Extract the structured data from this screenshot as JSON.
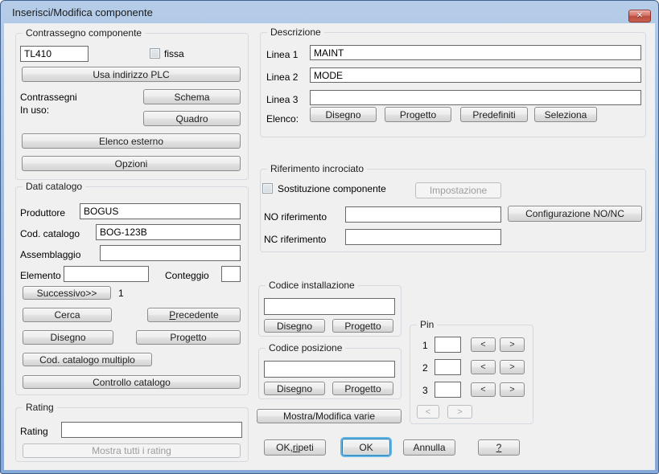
{
  "window": {
    "title": "Inserisci/Modifica componente"
  },
  "colors": {
    "titlebar_blue": "#a3bfe2",
    "frame_border": "#41618e",
    "close_red": "#c9604f",
    "default_button_ring": "#5fb5e4",
    "dialog_bg": "#f0f0f0"
  },
  "component_tag": {
    "group_label": "Contrassegno componente",
    "tag_value": "TL410",
    "fixed_checkbox_label": "fissa",
    "use_plc_button": "Usa indirizzo PLC",
    "in_use_line1": "Contrassegni",
    "in_use_line2": "In uso:",
    "schematic_button": "Schema",
    "panel_button": "Quadro",
    "external_list_button": "Elenco esterno",
    "options_button": "Opzioni"
  },
  "catalog": {
    "group_label": "Dati catalogo",
    "manufacturer_label": "Produttore",
    "manufacturer_value": "BOGUS",
    "catalog_label": "Cod. catalogo",
    "catalog_value": "BOG-123B",
    "assembly_label": "Assemblaggio",
    "assembly_value": "",
    "item_label": "Elemento",
    "item_value": "",
    "count_label": "Conteggio",
    "count_value": "",
    "next_button": "Successivo>>",
    "next_count": "1",
    "lookup_button": "Cerca",
    "previous_button_u": "P",
    "previous_button_rest": "recedente",
    "drawing_button": "Disegno",
    "project_button": "Progetto",
    "multiple_catalog_button": "Cod. catalogo multiplo",
    "catalog_check_button": "Controllo catalogo"
  },
  "rating": {
    "group_label": "Rating",
    "rating_label": "Rating",
    "rating_value": "",
    "show_all_button": "Mostra tutti i rating"
  },
  "description": {
    "group_label": "Descrizione",
    "line1_label": "Linea 1",
    "line1_value": "MAINT",
    "line2_label": "Linea 2",
    "line2_value": "MODE",
    "line3_label": "Linea 3",
    "line3_value": "",
    "list_label": "Elenco:",
    "drawing_button": "Disegno",
    "project_button": "Progetto",
    "defaults_button": "Predefiniti",
    "pick_button": "Seleziona"
  },
  "cross_reference": {
    "group_label": "Riferimento incrociato",
    "swap_checkbox_label": "Sostituzione componente",
    "setup_button": "Impostazione",
    "no_label": "NO riferimento",
    "no_value": "",
    "config_button": "Configurazione NO/NC",
    "nc_label": "NC riferimento",
    "nc_value": ""
  },
  "installation_code": {
    "group_label": "Codice installazione",
    "value": "",
    "drawing_button": "Disegno",
    "project_button": "Progetto"
  },
  "location_code": {
    "group_label": "Codice posizione",
    "value": "",
    "drawing_button": "Disegno",
    "project_button": "Progetto"
  },
  "pins": {
    "group_label": "Pin",
    "rows": [
      {
        "label": "1",
        "value": "",
        "prev": "<",
        "next": ">"
      },
      {
        "label": "2",
        "value": "",
        "prev": "<",
        "next": ">"
      },
      {
        "label": "3",
        "value": "",
        "prev": "<",
        "next": ">"
      }
    ],
    "nav_prev": "<",
    "nav_next": ">"
  },
  "misc": {
    "show_edit_button": "Mostra/Modifica varie"
  },
  "footer": {
    "ok_repeat_prefix": "OK, ",
    "ok_repeat_u": "ri",
    "ok_repeat_rest": "peti",
    "ok_button": "OK",
    "cancel_button": "Annulla",
    "help_button": "?"
  }
}
